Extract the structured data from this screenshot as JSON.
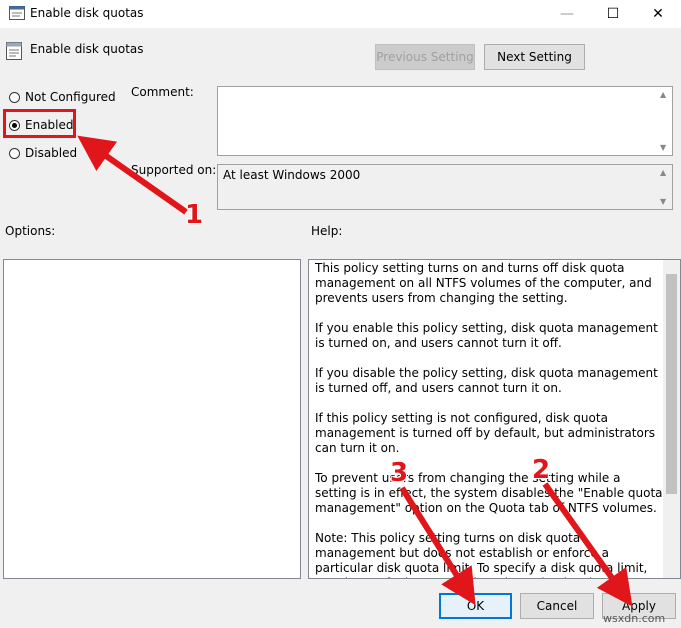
{
  "window": {
    "title": "Enable disk quotas",
    "controls": {
      "minimize": "—",
      "maximize": "☐",
      "close": "✕"
    }
  },
  "policy": {
    "title": "Enable disk quotas"
  },
  "nav": {
    "previous": "Previous Setting",
    "next": "Next Setting"
  },
  "state": {
    "options": [
      {
        "label": "Not Configured",
        "checked": false
      },
      {
        "label": "Enabled",
        "checked": true
      },
      {
        "label": "Disabled",
        "checked": false
      }
    ]
  },
  "comment": {
    "label": "Comment:",
    "value": ""
  },
  "supported": {
    "label": "Supported on:",
    "value": "At least Windows 2000"
  },
  "options_label": "Options:",
  "help": {
    "label": "Help:",
    "paragraphs": [
      "This policy setting turns on and turns off disk quota management on all NTFS volumes of the computer, and prevents users from changing the setting.",
      "If you enable this policy setting, disk quota management is turned on, and users cannot turn it off.",
      "If you disable the policy setting, disk quota management is turned off, and users cannot turn it on.",
      "If this policy setting is not configured, disk quota management is turned off by default, but administrators can turn it on.",
      "To prevent users from changing the setting while a setting is in effect, the system disables the \"Enable quota management\" option on the Quota tab of NTFS volumes.",
      "Note: This policy setting turns on disk quota management but does not establish or enforce a particular disk quota limit. To specify a disk quota limit, use the \"Default quota limit and warning level\" policy setting. Otherwise, the system uses the"
    ]
  },
  "buttons": {
    "ok": "OK",
    "cancel": "Cancel",
    "apply": "Apply"
  },
  "annotations": {
    "badge1": "1",
    "badge2": "2",
    "badge3": "3",
    "color": "#e0161b"
  },
  "watermark": "wsxdn.com"
}
